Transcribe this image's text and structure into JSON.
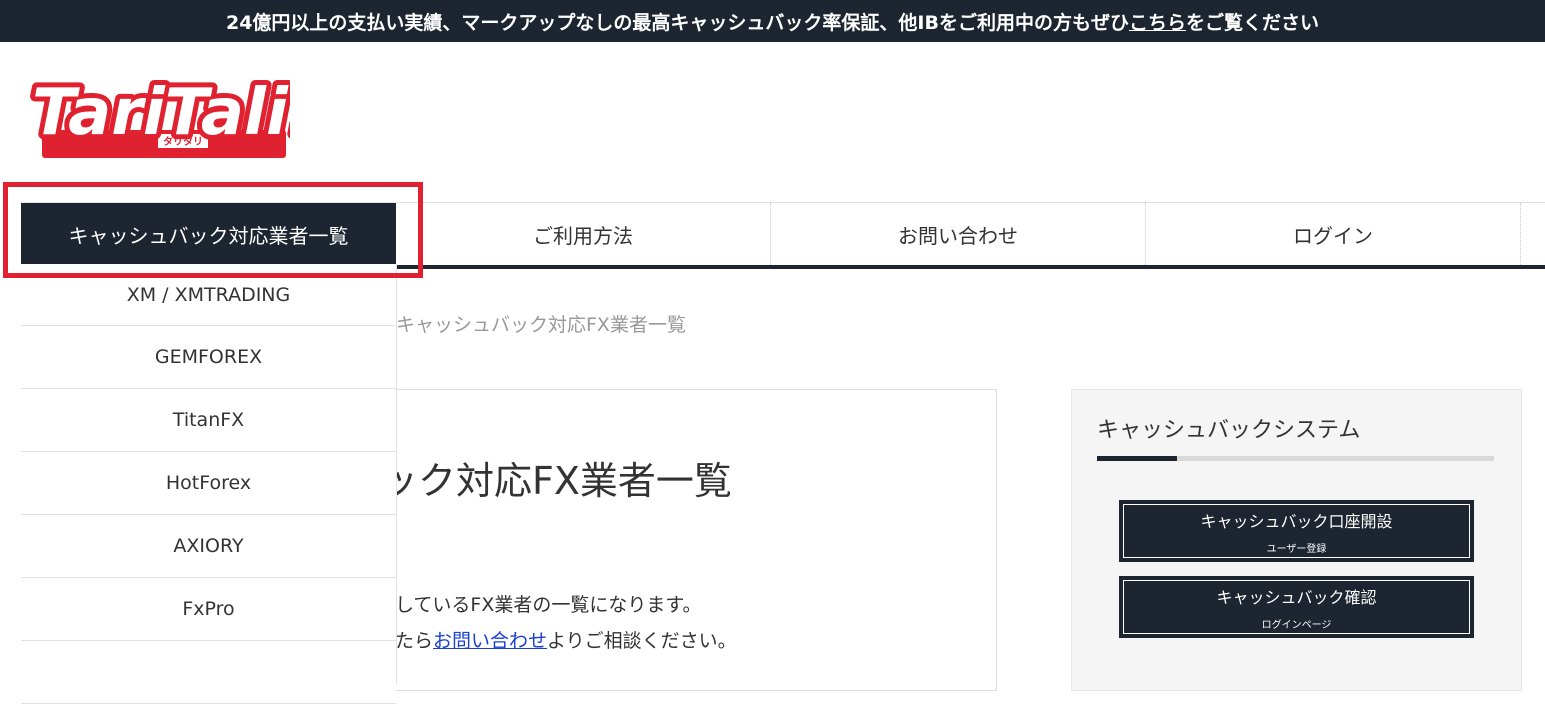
{
  "announcement": {
    "text_before": "24億円以上の支払い実績、マークアップなしの最高キャッシュバック率保証、他IBをご利用中の方もぜひ",
    "link_text": "こちら",
    "text_after": "をご覧ください"
  },
  "logo": {
    "text": "TariTali!",
    "subtext": "タリタリ"
  },
  "nav": {
    "items": [
      {
        "label": "キャッシュバック対応業者一覧"
      },
      {
        "label": "ご利用方法"
      },
      {
        "label": "お問い合わせ"
      },
      {
        "label": "ログイン"
      }
    ]
  },
  "dropdown": {
    "items": [
      {
        "label": "XM / XMTRADING"
      },
      {
        "label": "GEMFOREX"
      },
      {
        "label": "TitanFX"
      },
      {
        "label": "HotForex"
      },
      {
        "label": "AXIORY"
      },
      {
        "label": "FxPro"
      },
      {
        "label": ""
      }
    ]
  },
  "breadcrumb": {
    "current": "キャッシュバック対応FX業者一覧"
  },
  "main": {
    "title": "キャッシュバック対応FX業者一覧",
    "line1": "しているFX業者の一覧になります。",
    "line2_prefix": "たら",
    "line2_link": "お問い合わせ",
    "line2_suffix": "よりご相談ください。"
  },
  "sidebar": {
    "title": "キャッシュバックシステム",
    "buttons": [
      {
        "label": "キャッシュバック口座開設",
        "sub": "ユーザー登録"
      },
      {
        "label": "キャッシュバック確認",
        "sub": "ログインページ"
      }
    ]
  },
  "colors": {
    "navy": "#1c2530",
    "highlight": "#e0212f",
    "logo_red": "#e0212f"
  }
}
